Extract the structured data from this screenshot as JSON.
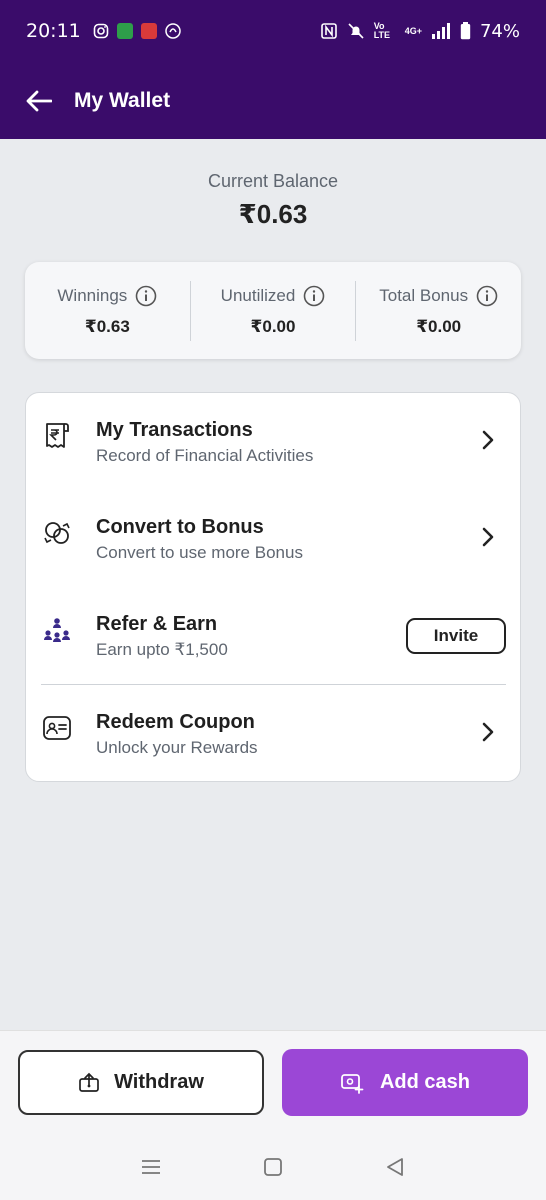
{
  "status_bar": {
    "time": "20:11",
    "net_label": "Vo LTE",
    "signal_label": "4G+",
    "battery": "74%"
  },
  "header": {
    "title": "My Wallet",
    "back_icon": "arrow-left-icon"
  },
  "balance": {
    "label": "Current Balance",
    "value": "₹0.63"
  },
  "summary": [
    {
      "label": "Winnings",
      "value": "₹0.63",
      "icon": "info-icon"
    },
    {
      "label": "Unutilized",
      "value": "₹0.00",
      "icon": "info-icon"
    },
    {
      "label": "Total Bonus",
      "value": "₹0.00",
      "icon": "info-icon"
    }
  ],
  "menu": {
    "items": [
      {
        "title": "My Transactions",
        "subtitle": "Record of Financial Activities",
        "icon": "receipt-rupee-icon"
      },
      {
        "title": "Convert to Bonus",
        "subtitle": "Convert to use more Bonus",
        "icon": "convert-coins-icon"
      },
      {
        "title": "Refer & Earn",
        "subtitle": "Earn upto ₹1,500",
        "icon": "people-network-icon",
        "action_label": "Invite"
      },
      {
        "title": "Redeem Coupon",
        "subtitle": "Unlock your Rewards",
        "icon": "coupon-card-icon"
      }
    ]
  },
  "actions": {
    "withdraw_label": "Withdraw",
    "add_cash_label": "Add cash"
  },
  "colors": {
    "header_bg": "#3a0c6a",
    "accent": "#9b47d6",
    "page_bg": "#e9ebee"
  }
}
